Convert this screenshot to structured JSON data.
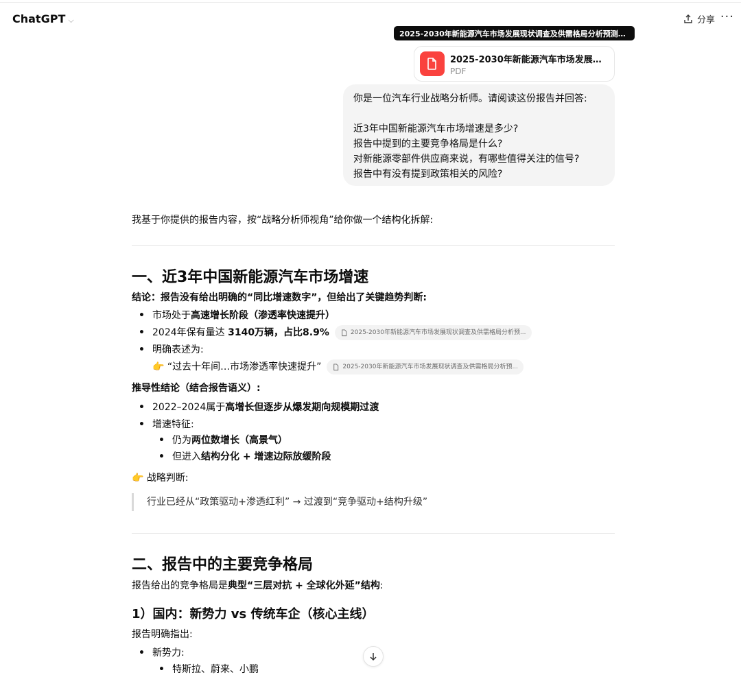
{
  "header": {
    "app_title": "ChatGPT",
    "share_label": "分享",
    "more_label": "···"
  },
  "tooltip": {
    "text": "2025-2030年新能源汽车市场发展现状调查及供需格局分析预测报..."
  },
  "attachment": {
    "name": "2025-2030年新能源汽车市场发展现...",
    "type": "PDF",
    "icon": "document-icon",
    "color": "#fa423e"
  },
  "user_message": {
    "line1": "你是一位汽车行业战略分析师。请阅读这份报告并回答:",
    "line2": "近3年中国新能源汽车市场增速是多少?",
    "line3": "报告中提到的主要竞争格局是什么?",
    "line4": "对新能源零部件供应商来说，有哪些值得关注的信号?",
    "line5": "报告中有没有提到政策相关的风险?"
  },
  "answer": {
    "intro": "我基于你提供的报告内容，按“战略分析师视角”给你做一个结构化拆解:",
    "section1": {
      "heading": "一、近3年中国新能源汽车市场增速",
      "conclusion": "结论：报告没有给出明确的“同比增速数字”，但给出了关键趋势判断:",
      "b1_pre": "市场处于",
      "b1_bold": "高速增长阶段（渗透率快速提升）",
      "b2_pre": "2024年保有量达 ",
      "b2_bold": "3140万辆，占比8.9%",
      "b3": "明确表述为:",
      "quote_line": "👉 “过去十年间…市场渗透率快速提升”",
      "citation": "2025-2030年新能源汽车市场发展现状调查及供需格局分析预...",
      "derived": "推导性结论（结合报告语义）:",
      "d1_pre": "2022–2024属于",
      "d1_bold": "高增长但逐步从爆发期向规模期过渡",
      "d2": "增速特征:",
      "d2a_pre": "仍为",
      "d2a_bold": "两位数增长（高景气）",
      "d2b_pre": "但进入",
      "d2b_bold": "结构分化 + 增速边际放缓阶段",
      "strategy": "👉 战略判断:",
      "blockquote": "行业已经从“政策驱动+渗透红利” → 过渡到“竞争驱动+结构升级”"
    },
    "section2": {
      "heading": "二、报告中的主要竞争格局",
      "intro_pre": "报告给出的竞争格局是",
      "intro_bold": "典型“三层对抗 + 全球化外延”结构",
      "intro_post": ":",
      "sub1": "1）国内：新势力 vs 传统车企（核心主线）",
      "sub1_text": "报告明确指出:",
      "n1": "新势力:",
      "n1a": "特斯拉、蔚来、小鹏"
    }
  },
  "scroll_button": {
    "icon": "arrow-down-icon"
  }
}
